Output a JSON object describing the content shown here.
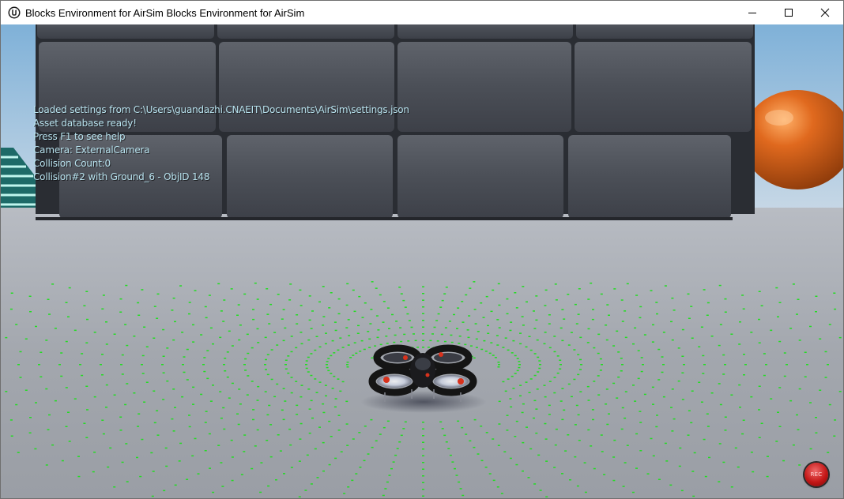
{
  "window": {
    "title": "Blocks Environment for AirSim Blocks Environment for AirSim",
    "app_icon": "unreal-engine-icon",
    "controls": {
      "minimize_icon": "minimize-icon",
      "maximize_icon": "maximize-icon",
      "close_icon": "close-icon"
    }
  },
  "hud": {
    "lines": [
      "Loaded settings from C:\\Users\\guandazhi.CNAEIT\\Documents\\AirSim\\settings.json",
      "Asset database ready!",
      "Press F1 to see help",
      "Camera: ExternalCamera",
      "Collision Count:0",
      "Collision#2 with Ground_6 - ObjID 148"
    ],
    "text_color": "#b8e2ee"
  },
  "scene": {
    "objects": [
      "block-wall",
      "orange-sphere",
      "striped-cone",
      "quadcopter-drone",
      "lidar-points"
    ],
    "lidar_color": "#22dd22",
    "sphere_color": "#e0691e",
    "ground_color": "#9fa3ab"
  },
  "record": {
    "label": "REC",
    "icon": "record-icon",
    "color": "#c41717"
  }
}
